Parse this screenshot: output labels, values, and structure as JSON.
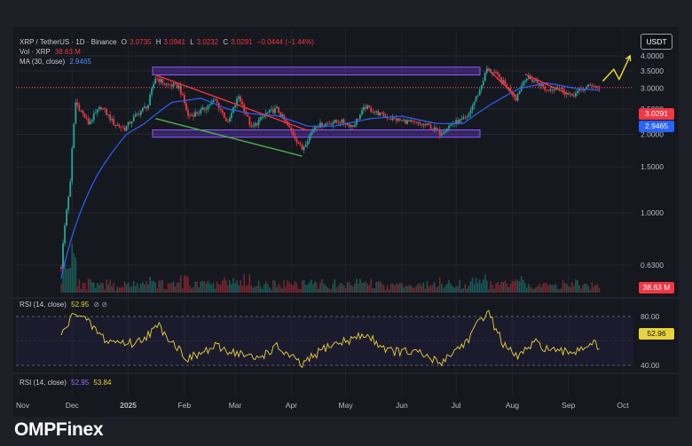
{
  "header": {
    "symbol": "XRP / TetherUS · 1D · Binance",
    "ohlc": [
      {
        "k": "O",
        "v": "3.0735"
      },
      {
        "k": "H",
        "v": "3.0941"
      },
      {
        "k": "L",
        "v": "3.0232"
      },
      {
        "k": "C",
        "v": "3.0291"
      }
    ],
    "change": "−0.0444 (−1.44%)",
    "vol_label": "Vol · XRP",
    "vol_value": "38.63 M",
    "ma_label": "MA (30, close)",
    "ma_value": "2.9465"
  },
  "rsi_pane": {
    "label": "RSI (14, close)",
    "value": "52.95",
    "icons": "⊘ ⊘"
  },
  "rsi_pane2": {
    "label": "RSI (14, close)",
    "value1": "52.95",
    "value2": "53.84"
  },
  "currency_button": "USDT",
  "brand": "OMPFinex",
  "tags": {
    "price": "3.0291",
    "ma": "2.9465",
    "vol": "38.63 M",
    "rsi": "52.96"
  },
  "colors": {
    "up": "#26a69a",
    "down": "#f23645",
    "ma": "#2962ff",
    "rsi": "#e8d33f",
    "zone": "#7b3ff2",
    "resistance_trend": "#f23645",
    "support_trend": "#4caf50",
    "projection": "#f7e32d"
  },
  "chart_data": {
    "type": "candlestick",
    "y_scale": "log",
    "ylim": [
      0.5,
      4.15
    ],
    "y_ticks": [
      "4.0000",
      "3.5000",
      "3.0000",
      "2.5000",
      "2.0000",
      "1.5000",
      "1.0000",
      "0.6300"
    ],
    "x_ticks": [
      "Nov",
      "Dec",
      "2025",
      "Feb",
      "Mar",
      "Apr",
      "May",
      "Jun",
      "Jul",
      "Aug",
      "Sep",
      "Oct"
    ],
    "price_anchors": [
      [
        "2024-11-25",
        0.62
      ],
      [
        "2024-11-30",
        1.3
      ],
      [
        "2024-12-03",
        2.65
      ],
      [
        "2024-12-10",
        2.2
      ],
      [
        "2024-12-17",
        2.55
      ],
      [
        "2024-12-24",
        2.2
      ],
      [
        "2024-12-30",
        2.1
      ],
      [
        "2025-01-05",
        2.35
      ],
      [
        "2025-01-12",
        2.6
      ],
      [
        "2025-01-16",
        3.3
      ],
      [
        "2025-01-22",
        3.1
      ],
      [
        "2025-01-29",
        3.05
      ],
      [
        "2025-02-03",
        2.35
      ],
      [
        "2025-02-10",
        2.45
      ],
      [
        "2025-02-18",
        2.7
      ],
      [
        "2025-02-25",
        2.2
      ],
      [
        "2025-03-03",
        2.8
      ],
      [
        "2025-03-10",
        2.1
      ],
      [
        "2025-03-18",
        2.4
      ],
      [
        "2025-03-24",
        2.5
      ],
      [
        "2025-03-31",
        2.1
      ],
      [
        "2025-04-07",
        1.75
      ],
      [
        "2025-04-14",
        2.15
      ],
      [
        "2025-04-21",
        2.2
      ],
      [
        "2025-04-28",
        2.25
      ],
      [
        "2025-05-05",
        2.15
      ],
      [
        "2025-05-12",
        2.55
      ],
      [
        "2025-05-19",
        2.4
      ],
      [
        "2025-05-26",
        2.3
      ],
      [
        "2025-06-02",
        2.25
      ],
      [
        "2025-06-09",
        2.2
      ],
      [
        "2025-06-16",
        2.15
      ],
      [
        "2025-06-22",
        2.02
      ],
      [
        "2025-06-29",
        2.2
      ],
      [
        "2025-07-07",
        2.3
      ],
      [
        "2025-07-14",
        2.95
      ],
      [
        "2025-07-18",
        3.55
      ],
      [
        "2025-07-22",
        3.45
      ],
      [
        "2025-07-28",
        3.1
      ],
      [
        "2025-08-03",
        2.75
      ],
      [
        "2025-08-08",
        3.3
      ],
      [
        "2025-08-14",
        3.2
      ],
      [
        "2025-08-20",
        2.95
      ],
      [
        "2025-08-26",
        3.05
      ],
      [
        "2025-09-02",
        2.8
      ],
      [
        "2025-09-08",
        2.95
      ],
      [
        "2025-09-14",
        3.1
      ],
      [
        "2025-09-18",
        3.03
      ]
    ],
    "ma30_anchors": [
      [
        "2024-11-25",
        0.56
      ],
      [
        "2024-12-15",
        1.4
      ],
      [
        "2024-12-31",
        2.0
      ],
      [
        "2025-01-10",
        2.2
      ],
      [
        "2025-01-25",
        2.65
      ],
      [
        "2025-02-10",
        2.75
      ],
      [
        "2025-02-25",
        2.5
      ],
      [
        "2025-03-10",
        2.4
      ],
      [
        "2025-03-25",
        2.35
      ],
      [
        "2025-04-10",
        2.15
      ],
      [
        "2025-04-25",
        2.15
      ],
      [
        "2025-05-15",
        2.3
      ],
      [
        "2025-06-01",
        2.35
      ],
      [
        "2025-06-20",
        2.2
      ],
      [
        "2025-07-05",
        2.2
      ],
      [
        "2025-07-20",
        2.6
      ],
      [
        "2025-08-05",
        3.0
      ],
      [
        "2025-08-20",
        3.15
      ],
      [
        "2025-09-05",
        3.0
      ],
      [
        "2025-09-18",
        2.95
      ]
    ],
    "rsi": {
      "levels": [
        "80.00",
        "40.00"
      ],
      "ylim": [
        20,
        90
      ],
      "anchors": [
        [
          "2024-11-25",
          64
        ],
        [
          "2024-12-03",
          85
        ],
        [
          "2024-12-20",
          60
        ],
        [
          "2025-01-05",
          58
        ],
        [
          "2025-01-18",
          72
        ],
        [
          "2025-02-03",
          45
        ],
        [
          "2025-02-18",
          55
        ],
        [
          "2025-03-03",
          50
        ],
        [
          "2025-03-12",
          45
        ],
        [
          "2025-03-24",
          55
        ],
        [
          "2025-04-07",
          40
        ],
        [
          "2025-04-20",
          55
        ],
        [
          "2025-05-12",
          65
        ],
        [
          "2025-05-25",
          52
        ],
        [
          "2025-06-10",
          50
        ],
        [
          "2025-06-22",
          42
        ],
        [
          "2025-07-07",
          60
        ],
        [
          "2025-07-18",
          85
        ],
        [
          "2025-07-28",
          55
        ],
        [
          "2025-08-03",
          47
        ],
        [
          "2025-08-14",
          58
        ],
        [
          "2025-08-26",
          50
        ],
        [
          "2025-09-05",
          52
        ],
        [
          "2025-09-14",
          59
        ],
        [
          "2025-09-18",
          53
        ]
      ]
    },
    "annotations": [
      {
        "type": "zone",
        "from": 3.38,
        "to": 3.62
      },
      {
        "type": "zone",
        "from": 1.95,
        "to": 2.08
      },
      {
        "type": "trendline",
        "role": "resistance",
        "points": [
          [
            "2025-01-16",
            3.38
          ],
          [
            "2025-04-10",
            2.07
          ]
        ]
      },
      {
        "type": "trendline",
        "role": "support",
        "points": [
          [
            "2025-01-16",
            2.3
          ],
          [
            "2025-04-07",
            1.65
          ]
        ]
      },
      {
        "type": "trendline",
        "role": "resistance",
        "points": [
          [
            "2025-07-18",
            3.58
          ],
          [
            "2025-08-03",
            2.8
          ]
        ]
      },
      {
        "type": "trendline",
        "role": "resistance",
        "points": [
          [
            "2025-08-08",
            3.4
          ],
          [
            "2025-09-01",
            2.85
          ]
        ]
      },
      {
        "type": "arrow",
        "role": "projection",
        "points": [
          [
            "2025-09-20",
            3.2
          ],
          [
            "2025-09-26",
            3.55
          ],
          [
            "2025-09-29",
            3.25
          ],
          [
            "2025-10-05",
            4.0
          ]
        ]
      }
    ]
  }
}
